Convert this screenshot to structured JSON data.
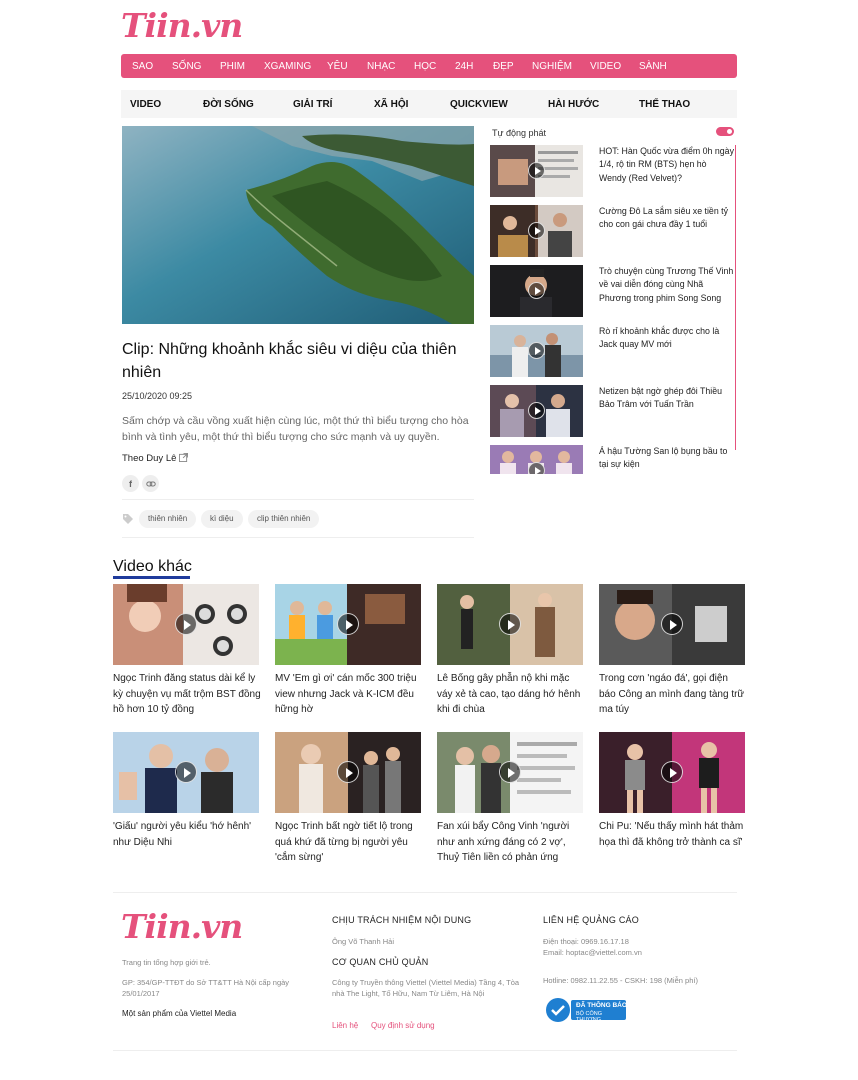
{
  "brand": {
    "logo_text": "Tiin.vn",
    "accent_color": "#e5517c"
  },
  "top_nav": [
    "SAO",
    "SỐNG",
    "PHIM",
    "XGAMING",
    "YÊU",
    "NHẠC",
    "HỌC",
    "24H",
    "ĐẸP",
    "NGHIỆM",
    "VIDEO",
    "SÀNH"
  ],
  "sub_nav": [
    "VIDEO",
    "ĐỜI SỐNG",
    "GIẢI TRÍ",
    "XÃ HỘI",
    "QUICKVIEW",
    "HÀI HƯỚC",
    "THỂ THAO"
  ],
  "article": {
    "title": "Clip: Những khoảnh khắc siêu vi diệu của thiên nhiên",
    "date": "25/10/2020 09:25",
    "description": "Sấm chớp và cầu vồng xuất hiện cùng lúc, một thứ thì biểu tượng cho hòa bình và tình yêu, một thứ thì biểu tượng cho sức mạnh và uy quyền.",
    "author": "Theo Duy Lê",
    "share_icons": [
      "facebook-icon",
      "link-icon"
    ],
    "tags": [
      "thiên nhiên",
      "kì diệu",
      "clip thiên nhiên"
    ]
  },
  "sidebar": {
    "autoplay_label": "Tự động phát",
    "autoplay_on": true,
    "items": [
      {
        "title": "HOT: Hàn Quốc vừa điểm 0h ngày 1/4, rộ tin RM (BTS) hẹn hò Wendy (Red Velvet)?"
      },
      {
        "title": "Cường Đô La sắm siêu xe tiền tỷ cho con gái chưa đầy 1 tuổi"
      },
      {
        "title": "Trò chuyện cùng Trương Thế Vinh về vai diễn đóng cùng Nhã Phương trong phim Song Song"
      },
      {
        "title": "Rò rỉ khoảnh khắc được cho là Jack quay MV mới"
      },
      {
        "title": "Netizen bật ngờ ghép đôi Thiều Bảo Trâm với Tuấn Trần"
      },
      {
        "title": "Á hậu Tường San lộ bụng bầu to tại sự kiện"
      }
    ]
  },
  "other_videos": {
    "heading": "Video khác",
    "items": [
      {
        "title": "Ngọc Trinh đăng status dài kể ly kỳ chuyện vụ mất trộm BST đồng hồ hơn 10 tỷ đồng"
      },
      {
        "title": "MV 'Em gì ơi' cán mốc 300 triệu view nhưng Jack và K-ICM đều hững hờ"
      },
      {
        "title": "Lê Bống gây phẫn nộ khi mặc váy xẻ tà cao, tạo dáng hớ hênh khi đi chùa"
      },
      {
        "title": "Trong cơn 'ngáo đá', gọi điện báo Công an mình đang tàng trữ ma túy"
      },
      {
        "title": "'Giấu' người yêu kiểu 'hớ hênh' như Diệu Nhi"
      },
      {
        "title": "Ngọc Trinh bất ngờ tiết lộ trong quá khứ đã từng bị người yêu 'cắm sừng'"
      },
      {
        "title": "Fan xúi bẩy Công Vinh 'người như anh xứng đáng có 2 vợ', Thuỷ Tiên liền có phản ứng"
      },
      {
        "title": "Chi Pu: 'Nếu thấy mình hát thảm họa thì đã không trở thành ca sĩ'"
      }
    ]
  },
  "footer": {
    "tagline": "Trang tin tổng hợp giới trẻ.",
    "license": "GP: 354/GP-TTĐT do Sở TT&TT Hà Nội cấp ngày 25/01/2017",
    "product_of": "Một sản phẩm của Viettel Media",
    "content_responsibility_heading": "CHỊU TRÁCH NHIỆM NỘI DUNG",
    "content_responsibility_name": "Ông Võ Thanh Hải",
    "managing_agency_heading": "CƠ QUAN CHỦ QUẢN",
    "managing_agency_text": "Công ty Truyền thông Viettel (Viettel Media) Tầng 4, Tòa nhà The Light, Tố Hữu, Nam Từ Liêm, Hà Nội",
    "contact_link": "Liên hệ",
    "terms_link": "Quy định sử dụng",
    "ads_heading": "LIÊN HỆ QUẢNG CÁO",
    "phone": "Điện thoại: 0969.16.17.18",
    "email": "Email: hoptac@viettel.com.vn",
    "hotline": "Hotline: 0982.11.22.55 - CSKH: 198 (Miễn phí)",
    "badge_line1": "ĐÃ THÔNG BÁO",
    "badge_line2": "BỘ CÔNG THƯƠNG"
  }
}
